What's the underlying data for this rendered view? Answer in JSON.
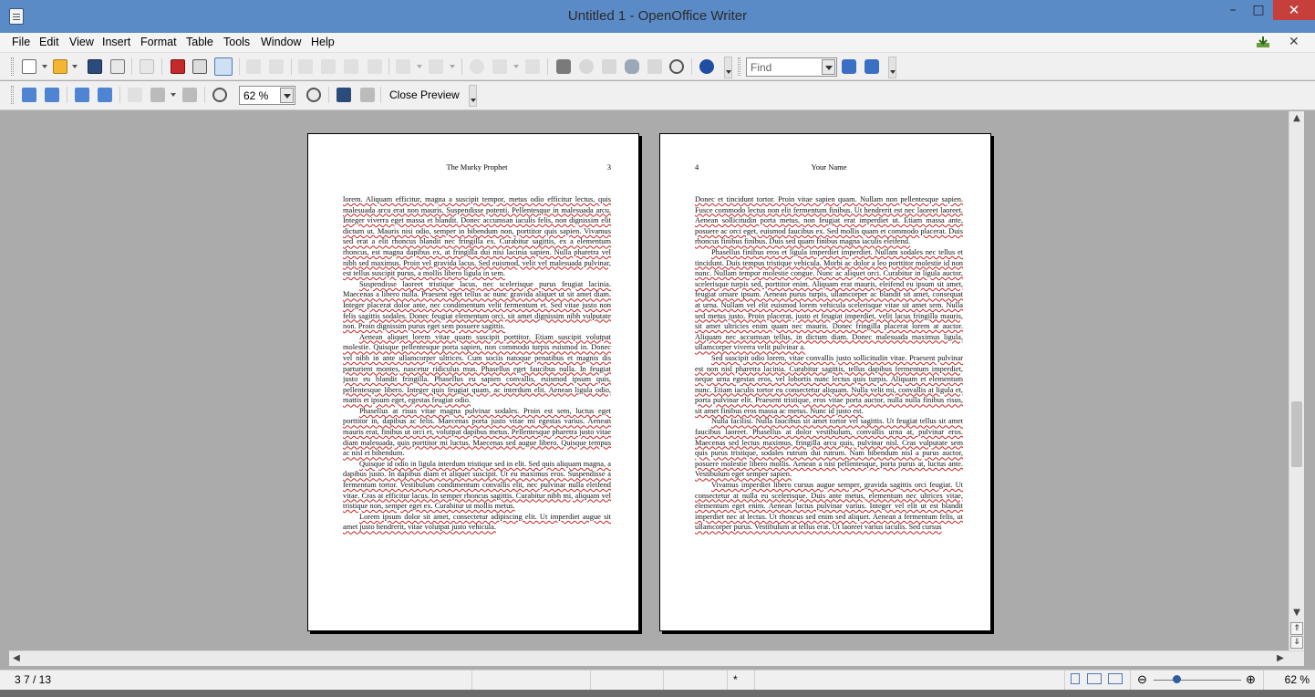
{
  "window": {
    "title": "Untitled 1 - OpenOffice Writer",
    "minimize": "–",
    "maximize": "□",
    "close": "✕"
  },
  "menu": [
    "File",
    "Edit",
    "View",
    "Insert",
    "Format",
    "Table",
    "Tools",
    "Window",
    "Help"
  ],
  "menu_right": {
    "close_doc": "✕"
  },
  "find": {
    "placeholder": "Find",
    "value": "Find"
  },
  "preview_toolbar": {
    "zoom": "62 %",
    "close_preview": "Close Preview"
  },
  "pages": [
    {
      "header_center": "The Murky Prophet",
      "header_number": "3",
      "paragraphs": [
        "lorem. Aliquam efficitur, magna a suscipit tempor, metus odio efficitur lectus, quis malesuada arcu erat non mauris. Suspendisse potenti. Pellentesque in malesuada arcu. Integer viverra eget massa et blandit. Donec accumsan iaculis felis, non dignissim elit dictum ut. Mauris nisi odio, semper in bibendum non, porttitor quis sapien. Vivamus sed erat a elit rhoncus blandit nec fringilla ex. Curabitur sagittis, ex a elementum rhoncus, est magna dapibus ex, at fringilla dui nisi lacinia sapien. Nulla pharetra vel nibh sed maximus. Proin vel gravida lacus. Sed euismod, velit vel malesuada pulvinar, est tellus suscipit purus, a mollis libero ligula in sem.",
        "Suspendisse laoreet tristique lacus, nec scelerisque purus feugiat lacinia. Maecenas a libero nulla. Praesent eget tellus ac nunc gravida aliquet ut sit amet diam. Integer placerat dolor ante, nec condimentum velit fermentum et. Sed vitae justo non felis sagittis sodales. Donec feugiat elementum orci, sit amet dignissim nibh vulputate non. Proin dignissim purus eget sem posuere sagittis.",
        "Aenean aliquet lorem vitae quam suscipit porttitor. Etiam suscipit volutpat molestie. Quisque pellentesque porta sapien, non commodo turpis euismod in. Donec vel nibh in ante ullamcorper ultrices. Cum sociis natoque penatibus et magnis dis parturient montes, nascetur ridiculus mus. Phasellus eget faucibus nulla. In feugiat justo eu blandit fringilla. Phasellus eu sapien convallis, euismod ipsum quis, pellentesque libero. Integer quis feugiat quam, ac interdum elit. Aenean ligula odio, mattis et ipsum eget, egestas feugiat odio.",
        "Phasellus at risus vitae magna pulvinar sodales. Proin est sem, luctus eget porttitor in, dapibus ac felis. Maecenas porta justo vitae mi egestas varius. Aenean mauris erat, finibus ut orci et, volutpat dapibus metus. Pellentesque pharetra justo vitae diam malesuada, quis porttitor mi luctus. Maecenas sed augue libero. Quisque tempus ac nisl et bibendum.",
        "Quisque id odio in ligula interdum tristique sed in elit. Sed quis aliquam magna, a dapibus justo. In dapibus diam et aliquet suscipit. Ut eu maximus eros. Suspendisse a fermentum tortor. Vestibulum condimentum convallis elit, nec pulvinar nulla eleifend vitae. Cras at efficitur lacus. In semper rhoncus sagittis. Curabitur nibh mi, aliquam vel tristique non, semper eget ex. Curabitur ut mollis metus.",
        "Lorem ipsum dolor sit amet, consectetur adipiscing elit. Ut imperdiet augue sit amet justo hendrerit, vitae volutpat justo vehicula."
      ]
    },
    {
      "header_number": "4",
      "header_center": "Your Name",
      "paragraphs": [
        "Donec et tincidunt tortor. Proin vitae sapien quam. Nullam non pellentesque sapien. Fusce commodo lectus non elit fermentum finibus. Ut hendrerit est nec laoreet laoreet. Aenean sollicitudin porta metus, non feugiat erat imperdiet ut. Etiam massa ante, posuere ac orci eget, euismod faucibus ex. Sed mollis quam et commodo placerat. Duis rhoncus finibus finibus. Duis sed quam finibus magna iaculis eleifend.",
        "Phasellus finibus eros et ligula imperdiet imperdiet. Nullam sodales nec tellus et tincidunt. Duis tempus tristique vehicula. Morbi ac dolor a leo porttitor molestie id non nunc. Nullam tempor molestie congue. Nunc ac aliquet orci. Curabitur in ligula auctor, scelerisque turpis sed, porttitor enim. Aliquam erat mauris, eleifend eu ipsum sit amet, feugiat ornare ipsum. Aenean purus turpis, ullamcorper ac blandit sit amet, consequat at urna. Nullam vel elit euismod lorem vehicula scelerisque vitae sit amet sem. Nulla sed metus justo. Proin placerat, justo et feugiat imperdiet, velit lacus fringilla mauris, sit amet ultricies enim quam nec mauris. Donec fringilla placerat lorem at auctor. Aliquam nec accumsan tellus, in dictum diam. Donec malesuada maximus ligula, ullamcorper viverra velit pulvinar a.",
        "Sed suscipit odio lorem, vitae convallis justo sollicitudin vitae. Praesent pulvinar est non nisl pharetra lacinia. Curabitur sagittis, tellus dapibus fermentum imperdiet, neque urna egestas eros, vel lobortis nunc lectus quis turpis. Aliquam et elementum nunc. Etiam iaculis tortor eu consectetur aliquam. Nulla velit mi, convallis at ligula et, porta pulvinar elit. Praesent tristique, eros vitae porta auctor, nulla nulla finibus risus, sit amet finibus eros massa ac metus. Nunc id justo est.",
        "Nulla facilisi. Nulla faucibus sit amet tortor vel sagittis. Ut feugiat tellus sit amet faucibus laoreet. Phasellus at dolor vestibulum, convallis urna at, pulvinar eros. Maecenas sed lectus maximus, fringilla arcu quis, pulvinar nisl. Cras vulputate sem quis purus tristique, sodales rutrum dui rutrum. Nam bibendum nisl a purus auctor, posuere molestie libero mollis. Aenean a nisi pellentesque, porta purus at, luctus ante. Vestibulum eget semper sapien.",
        "Vivamus imperdiet libero cursus augue semper, gravida sagittis orci feugiat. Ut consectetur at nulla eu scelerisque. Duis ante metus, elementum nec ultrices vitae, elementum eget enim. Aenean luctus pulvinar varius. Integer vel elit ut est blandit imperdiet nec at lectus. Ut rhoncus sed enim sed aliquet. Aenean a fermentum felis, ut ullamcorper purus. Vestibulum at tellus erat. Ut laoreet varius iaculis. Sed cursus"
      ]
    }
  ],
  "status": {
    "page": "3 7 / 13",
    "modified": "*",
    "zoom": "62 %",
    "zoom_minus": "⊖",
    "zoom_plus": "⊕"
  },
  "colors": {
    "titlebar": "#5b8bc7",
    "close": "#c73f3a",
    "spell_underline": "#cc2222"
  }
}
